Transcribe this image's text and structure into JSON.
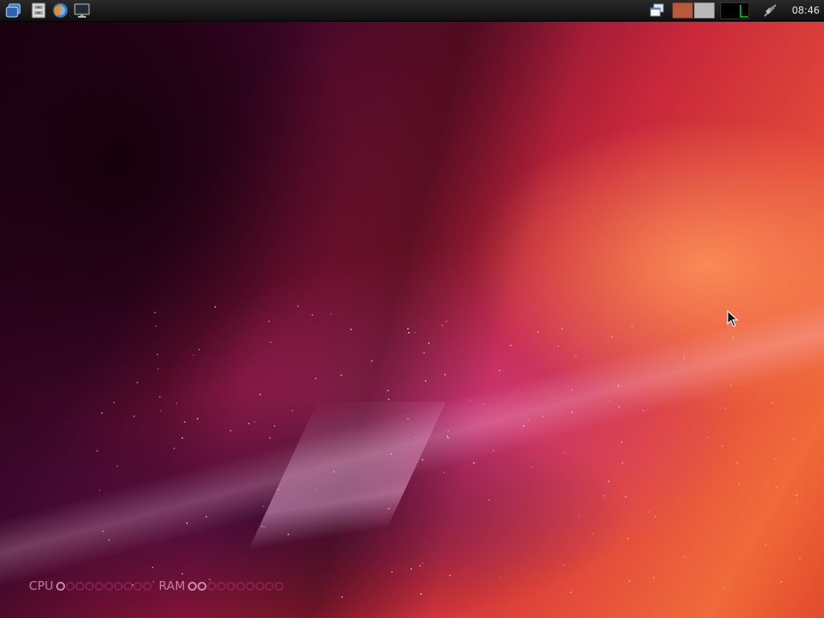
{
  "panel": {
    "launchers": [
      {
        "name": "application-menu-icon"
      },
      {
        "name": "file-manager-icon"
      },
      {
        "name": "web-browser-icon"
      },
      {
        "name": "terminal-icon"
      }
    ],
    "clock": "08:46"
  },
  "conky": {
    "cpu_label": "CPU",
    "ram_label": "RAM",
    "cpu_level": 0.1,
    "ram_level": 0.2
  },
  "colors": {
    "workspace_active": "#b95a3c",
    "workspace_inactive": "#b8b8b8",
    "cpu_graph_line": "#00e000"
  }
}
